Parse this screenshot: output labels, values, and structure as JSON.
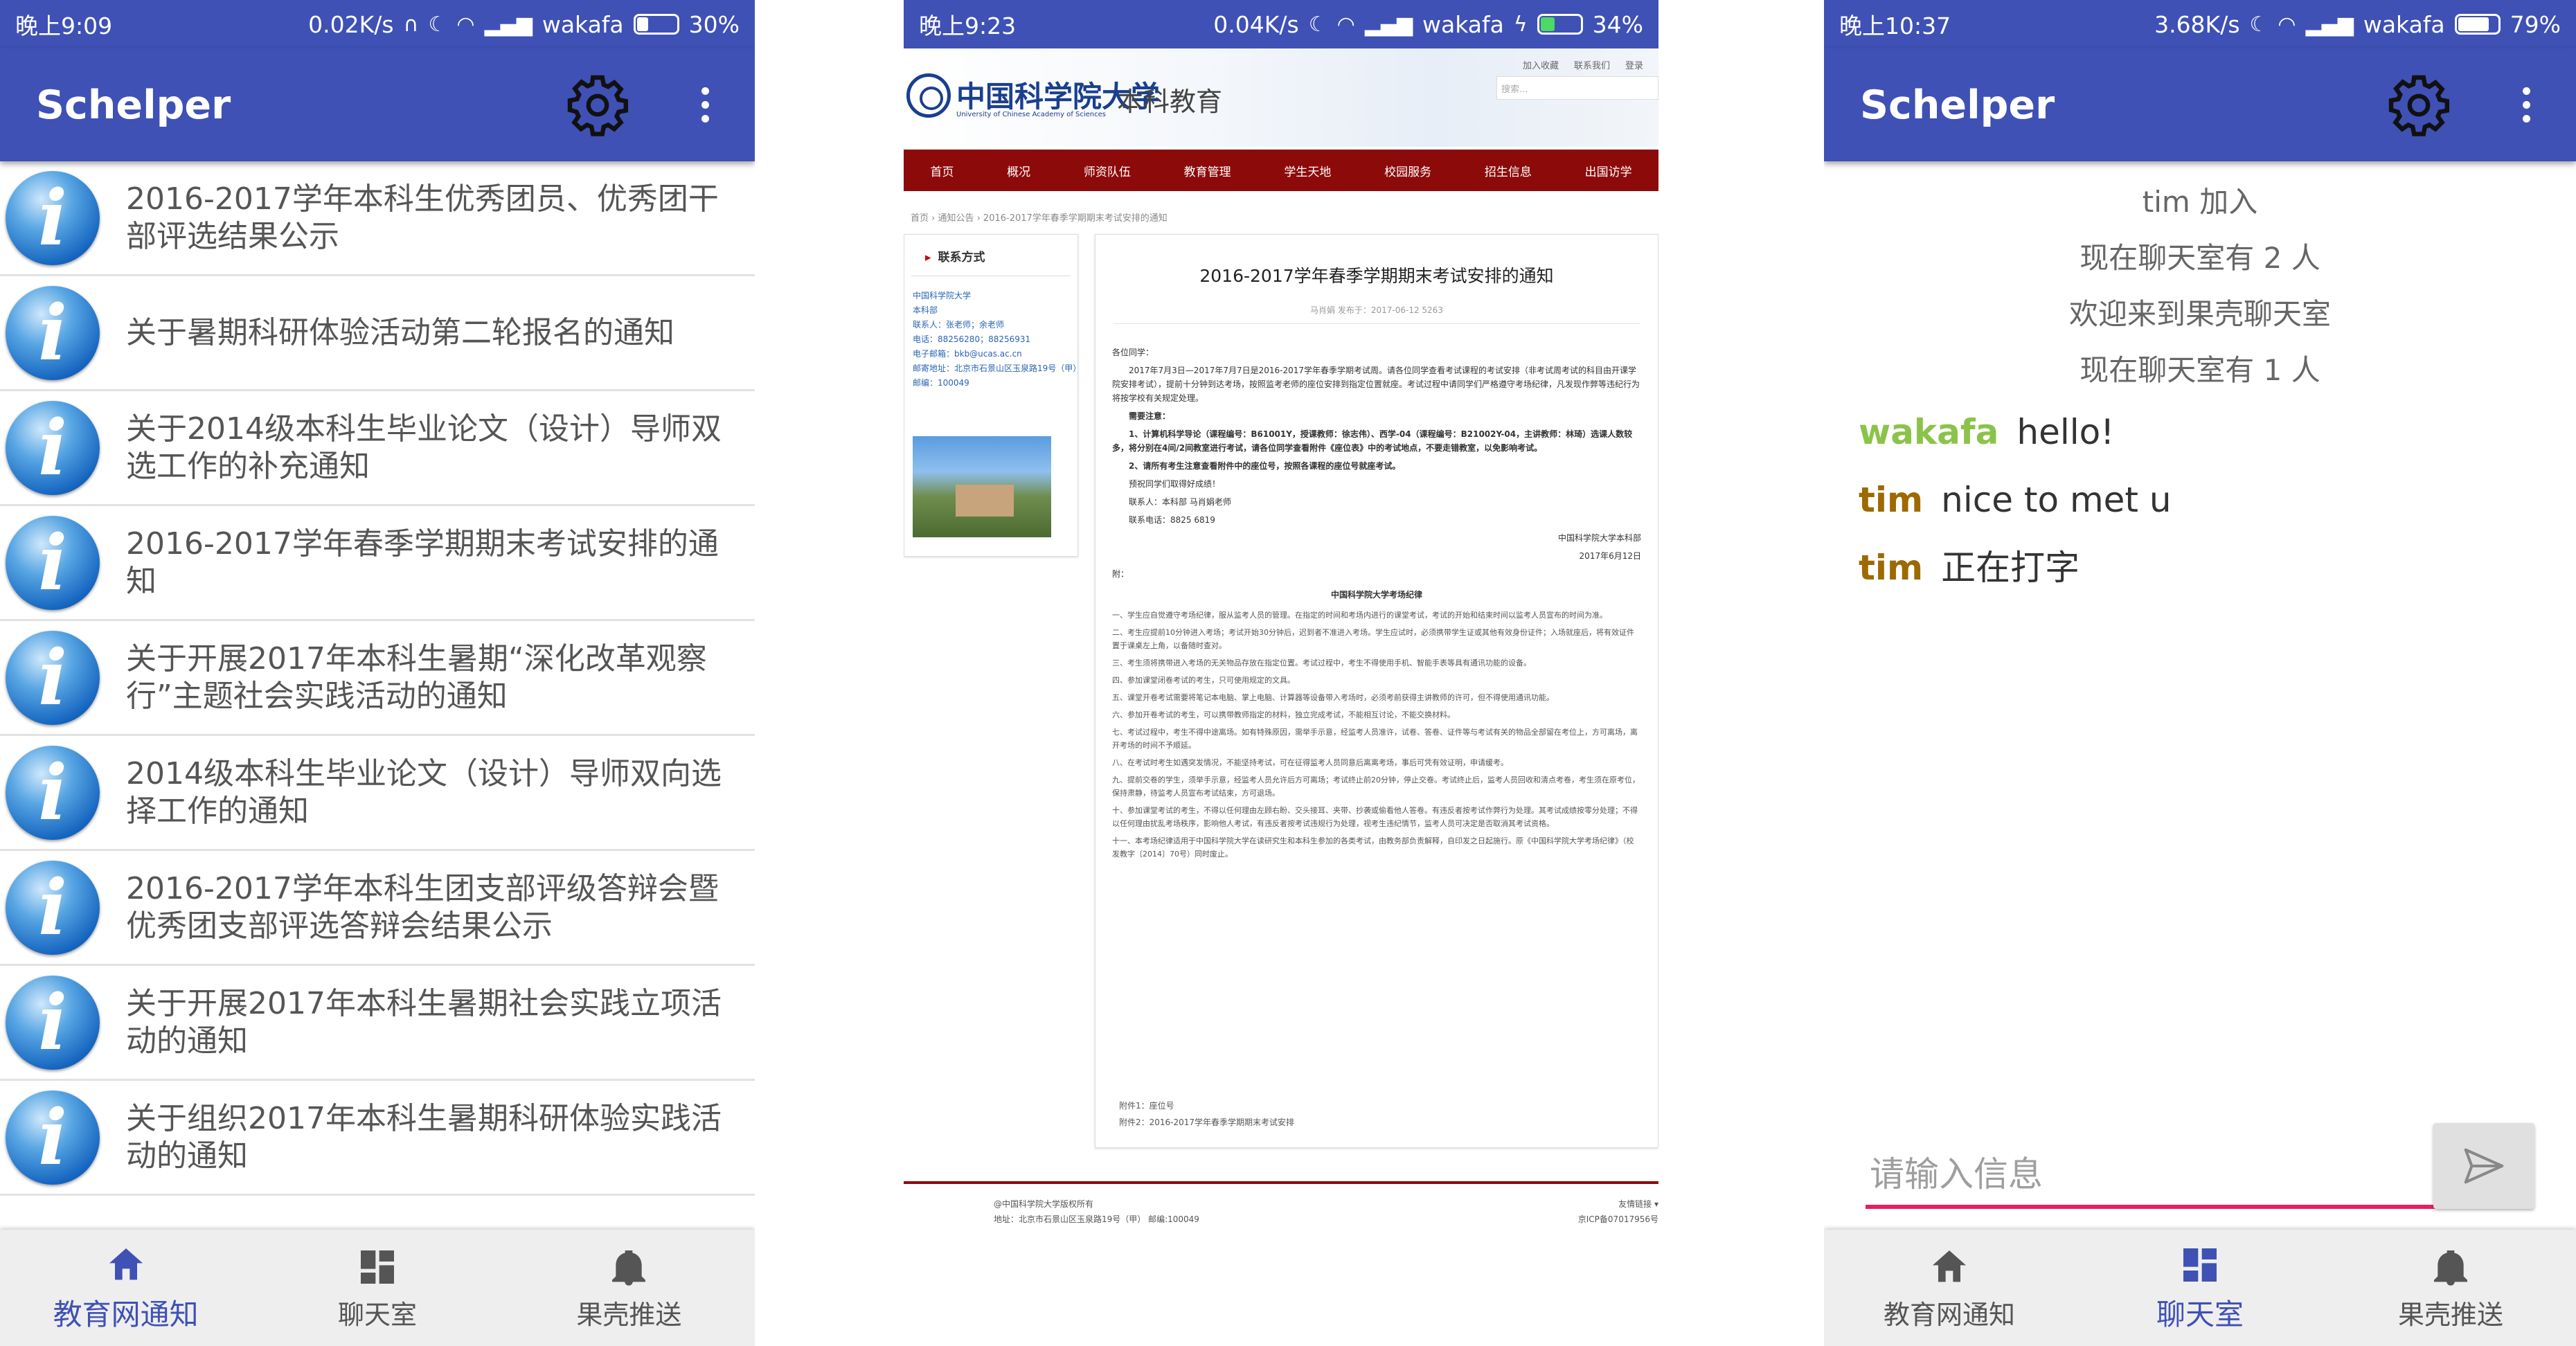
{
  "screen1": {
    "status": {
      "time": "晚上9:09",
      "speed": "0.02K/s",
      "carrier": "wakafa",
      "battery": "30%",
      "battery_level": 0.3
    },
    "app_title": "Schelper",
    "news_items": [
      "2016-2017学年本科生优秀团员、优秀团干部评选结果公示",
      "关于暑期科研体验活动第二轮报名的通知",
      "关于2014级本科生毕业论文（设计）导师双选工作的补充通知",
      "2016-2017学年春季学期期末考试安排的通知",
      "关于开展2017年本科生暑期“深化改革观察行”主题社会实践活动的通知",
      "2014级本科生毕业论文（设计）导师双向选择工作的通知",
      "2016-2017学年本科生团支部评级答辩会暨优秀团支部评选答辩会结果公示",
      "关于开展2017年本科生暑期社会实践立项活动的通知",
      "关于组织2017年本科生暑期科研体验实践活动的通知"
    ],
    "nav": {
      "notice": "教育网通知",
      "chat": "聊天室",
      "push": "果壳推送"
    }
  },
  "screen2": {
    "status": {
      "time": "晚上9:23",
      "speed": "0.04K/s",
      "carrier": "wakafa",
      "battery": "34%",
      "battery_level": 0.34
    },
    "site": {
      "logo_cn": "中国科学院大学",
      "logo_en": "University of Chinese Academy of Sciences",
      "logo_sub": "本科教育",
      "top_links": [
        "加入收藏",
        "联系我们",
        "登录"
      ],
      "search_placeholder": "搜索...",
      "menu": [
        "首页",
        "概况",
        "师资队伍",
        "教育管理",
        "学生天地",
        "校园服务",
        "招生信息",
        "出国访学"
      ],
      "breadcrumb": "首页 › 通知公告 › 2016-2017学年春季学期期末考试安排的通知",
      "contact_title": "联系方式",
      "contact_lines": [
        "中国科学院大学",
        "本科部",
        "联系人：张老师；余老师",
        "电话：88256280；88256931",
        "电子邮箱：bkb@ucas.ac.cn",
        "邮寄地址：北京市石景山区玉泉路19号（甲）",
        "邮编：100049"
      ],
      "article_title": "2016-2017学年春季学期期末考试安排的通知",
      "article_meta": "马肖娟    发布于：2017-06-12    5263",
      "greeting": "各位同学：",
      "para1": "2017年7月3日—2017年7月7日是2016-2017学年春季学期考试周。请各位同学查看考试课程的考试安排（非考试周考试的科目由开课学院安排考试），提前十分钟到达考场，按照监考老师的座位安排到指定位置就座。考试过程中请同学们严格遵守考场纪律，凡发现作弊等违纪行为将按学校有关规定处理。",
      "note_title": "需要注意：",
      "note1": "1、计算机科学导论（课程编号：B61001Y，授课教师：徐志伟）、西学-04（课程编号：B21002Y-04，主讲教师：林琦）选课人数较多，将分别在4间/2间教室进行考试，请各位同学查看附件《座位表》中的考试地点，不要走错教室，以免影响考试。",
      "note2": "2、请所有考生注意查看附件中的座位号，按照各课程的座位号就座考试。",
      "wish": "预祝同学们取得好成绩！",
      "contact_person": "联系人：本科部 马肖娟老师",
      "contact_phone": "联系电话：8825 6819",
      "signature": "中国科学院大学本科部",
      "date": "2017年6月12日",
      "attach_label": "附：",
      "rules_title": "中国科学院大学考场纪律",
      "rules": [
        "一、学生应自觉遵守考场纪律，服从监考人员的管理。在指定的时间和考场内进行的课堂考试，考试的开始和结束时间以监考人员宣布的时间为准。",
        "二、考生应提前10分钟进入考场；考试开始30分钟后，迟到者不准进入考场。学生应试时，必须携带学生证或其他有效身份证件；入场就座后，将有效证件置于课桌左上角，以备随时查对。",
        "三、考生须将携带进入考场的无关物品存放在指定位置。考试过程中，考生不得使用手机、智能手表等具有通讯功能的设备。",
        "四、参加课堂闭卷考试的考生，只可使用规定的文具。",
        "五、课堂开卷考试需要将笔记本电脑、掌上电脑、计算器等设备带入考场时，必须考前获得主讲教师的许可，但不得使用通讯功能。",
        "六、参加开卷考试的考生，可以携带教师指定的材料，独立完成考试，不能相互讨论，不能交换材料。",
        "七、考试过程中，考生不得中途离场。如有特殊原因，需举手示意，经监考人员准许，试卷、答卷、证件等与考试有关的物品全部留在考位上，方可离场，离开考场的时间不予顺延。",
        "八、在考试时考生如遇突发情况，不能坚持考试，可在征得监考人员同意后离离考场，事后可凭有效证明，申请缓考。",
        "九、提前交卷的学生，须举手示意，经监考人员允许后方可离场；考试终止前20分钟，停止交卷。考试终止后，监考人员回收和清点考卷，考生须在原考位，保持肃静，待监考人员宣布考试结束，方可退场。",
        "十、参加课堂考试的考生，不得以任何理由左顾右盼、交头接耳、夹带、抄袭或偷看他人答卷。有违反者按考试作弊行为处理。其考试成绩按零分处理；不得以任何理由扰乱考场秩序，影响他人考试，有违反者按考试违规行为处理，视考生违纪情节，监考人员可决定是否取消其考试资格。",
        "十一、本考场纪律适用于中国科学院大学在读研究生和本科生参加的各类考试，由教务部负责解释，自印发之日起施行。原《中国科学院大学考场纪律》（校发教字〔2014〕70号）同时废止。"
      ],
      "attachments": [
        "附件1：座位号",
        "附件2：2016-2017学年春季学期期末考试安排"
      ],
      "footer_left": [
        "@中国科学院大学版权所有",
        "地址：北京市石景山区玉泉路19号（甲） 邮编:100049"
      ],
      "footer_right": [
        "友情链接 ▾",
        "京ICP备07017956号"
      ]
    }
  },
  "screen3": {
    "status": {
      "time": "晚上10:37",
      "speed": "3.68K/s",
      "carrier": "wakafa",
      "battery": "79%",
      "battery_level": 0.79
    },
    "app_title": "Schelper",
    "system_messages": [
      "tim 加入",
      "现在聊天室有 2 人",
      "欢迎来到果壳聊天室",
      "现在聊天室有 1 人"
    ],
    "messages": [
      {
        "user": "wakafa",
        "text": "hello!",
        "color": "#8bc34a"
      },
      {
        "user": "tim",
        "text": "nice to met u",
        "color": "#9c6a00"
      },
      {
        "user": "tim",
        "text": "正在打字",
        "color": "#9c6a00"
      }
    ],
    "input_placeholder": "请输入信息",
    "nav": {
      "notice": "教育网通知",
      "chat": "聊天室",
      "push": "果壳推送"
    }
  },
  "colors": {
    "primary": "#3f51b5",
    "accent": "#e91e63",
    "web_red": "#8d0a0a",
    "statusbar": "#3f51b5"
  }
}
